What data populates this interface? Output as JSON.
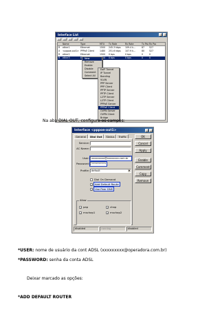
{
  "interface_list": {
    "title": "Interface List",
    "columns": [
      "",
      "Name",
      "Type",
      "MTU",
      "Tx Rate",
      "Rx Rate",
      "Tx Pac...",
      "Rx Pac..."
    ],
    "rows": [
      [
        "R",
        "ether1",
        "Ethernet",
        "1500",
        "245.3 kbps",
        "109.4 k...",
        "87",
        "527"
      ],
      [
        "X",
        "<pppoe-out1>",
        "PPPoE Client",
        "1480",
        "251.6 kbps",
        "107.9 k...",
        "80",
        "527"
      ],
      [
        "R",
        "ether2",
        "Ethernet",
        "1500",
        "0 bps",
        "0 bps",
        "0",
        "0"
      ],
      [
        "R",
        "ether3",
        "Ethernet",
        "1500",
        "0 bps",
        "0 bps",
        "0",
        "0"
      ]
    ],
    "context_menu": [
      "New",
      "Remove",
      "Enable",
      "Disable",
      "Comment",
      "Select All"
    ],
    "submenu": [
      "EoIP Tunnel",
      "IP Tunnel",
      "Bonding",
      "VLAN",
      "PPP Server",
      "PPP Client",
      "PPTP Server",
      "PPTP Client",
      "L2TP Server",
      "L2TP Client",
      "PPPoE Server",
      "PPPoE Client",
      "OVPN Server",
      "OVPN Client",
      "Bridge"
    ],
    "submenu_selected_index": 11
  },
  "caption_1": "Na aba DIAL OUT, configure os campos:",
  "dialog": {
    "title": "Interface <pppoe-out1>",
    "tabs": [
      "General",
      "Dial Out",
      "Status",
      "Traffic"
    ],
    "active_tab_index": 1,
    "service_label": "Service:",
    "service_value": "",
    "ac_name_label": "AC Name:",
    "ac_name_value": "",
    "user_label": "User:",
    "user_value": "xxxxxxxxx@xxxxxxxx.com.br",
    "password_label": "Password:",
    "password_value": "••••••••••",
    "profile_label": "Profile:",
    "profile_value": "default",
    "dial_on_demand": "Dial On Demand",
    "add_default_route": "Add Default Route",
    "use_peer_dns": "Use Peer DNS",
    "allow_label": "Allow",
    "allow_options": [
      "pap",
      "chap",
      "mschap1",
      "mschap2"
    ],
    "buttons": [
      "OK",
      "Cancel",
      "Apply",
      "Enable",
      "Comment",
      "Copy",
      "Remove"
    ],
    "status": [
      "disabled",
      "running",
      "disabled"
    ]
  },
  "caption_user_bold": "*USER:",
  "caption_user_rest": " nome de usuário da cont ADSL (xxxxxxxxx@operadora.com.br)",
  "caption_password_bold": "*PASSWORD:",
  "caption_password_rest": " senha da conta ADSL",
  "caption_marked": "Deixar marcado as opções:",
  "caption_default_route": "*ADD DEFAULT ROUTER"
}
